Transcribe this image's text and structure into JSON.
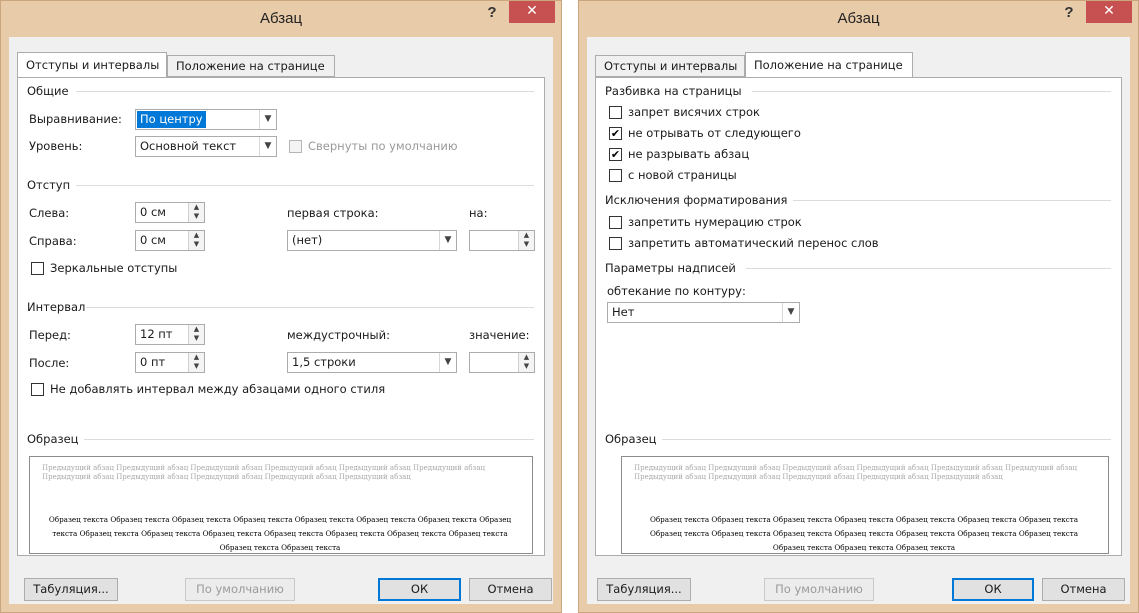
{
  "left": {
    "title": "Абзац",
    "help": "?",
    "close": "✕",
    "tabs": [
      "Отступы и интервалы",
      "Положение на странице"
    ],
    "general": {
      "group": "Общие",
      "align_label": "Выравнивание:",
      "align_value": "По центру",
      "level_label": "Уровень:",
      "level_value": "Основной текст",
      "collapsed_label": "Свернуты по умолчанию"
    },
    "indent": {
      "group": "Отступ",
      "left_label": "Слева:",
      "left_value": "0 см",
      "right_label": "Справа:",
      "right_value": "0 см",
      "first_line_label": "первая строка:",
      "first_line_value": "(нет)",
      "by_label": "на:",
      "by_value": "",
      "mirror_label": "Зеркальные отступы"
    },
    "spacing": {
      "group": "Интервал",
      "before_label": "Перед:",
      "before_value": "12 пт",
      "after_label": "После:",
      "after_value": "0 пт",
      "line_label": "междустрочный:",
      "line_value": "1,5 строки",
      "at_label": "значение:",
      "at_value": "",
      "no_space_label": "Не добавлять интервал между абзацами одного стиля"
    },
    "preview": {
      "group": "Образец",
      "grey": "Предыдущий абзац Предыдущий абзац Предыдущий абзац Предыдущий абзац Предыдущий абзац Предыдущий абзац Предыдущий абзац Предыдущий абзац Предыдущий абзац Предыдущий абзац Предыдущий абзац",
      "sample": "Образец текста Образец текста Образец текста Образец текста Образец текста Образец текста Образец текста Образец текста Образец текста Образец текста Образец текста Образец текста Образец текста Образец текста Образец текста Образец текста Образец текста"
    },
    "buttons": {
      "tabs": "Табуляция...",
      "default": "По умолчанию",
      "ok": "ОК",
      "cancel": "Отмена"
    }
  },
  "right": {
    "title": "Абзац",
    "help": "?",
    "close": "✕",
    "tabs": [
      "Отступы и интервалы",
      "Положение на странице"
    ],
    "pagination": {
      "group": "Разбивка на страницы",
      "items": [
        {
          "label": "запрет висячих строк",
          "checked": false
        },
        {
          "label": "не отрывать от следующего",
          "checked": true
        },
        {
          "label": "не разрывать абзац",
          "checked": true
        },
        {
          "label": "с новой страницы",
          "checked": false
        }
      ]
    },
    "exceptions": {
      "group": "Исключения форматирования",
      "items": [
        {
          "label": "запретить нумерацию строк",
          "checked": false
        },
        {
          "label": "запретить автоматический перенос слов",
          "checked": false
        }
      ]
    },
    "textbox": {
      "group": "Параметры надписей",
      "wrap_label": "обтекание по контуру:",
      "wrap_value": "Нет"
    },
    "preview": {
      "group": "Образец",
      "grey": "Предыдущий абзац Предыдущий абзац Предыдущий абзац Предыдущий абзац Предыдущий абзац Предыдущий абзац Предыдущий абзац Предыдущий абзац Предыдущий абзац Предыдущий абзац Предыдущий абзац",
      "sample": "Образец текста Образец текста Образец текста Образец текста Образец текста Образец текста Образец текста Образец текста Образец текста Образец текста Образец текста Образец текста Образец текста Образец текста Образец текста Образец текста Образец текста"
    },
    "buttons": {
      "tabs": "Табуляция...",
      "default": "По умолчанию",
      "ok": "ОК",
      "cancel": "Отмена"
    }
  }
}
